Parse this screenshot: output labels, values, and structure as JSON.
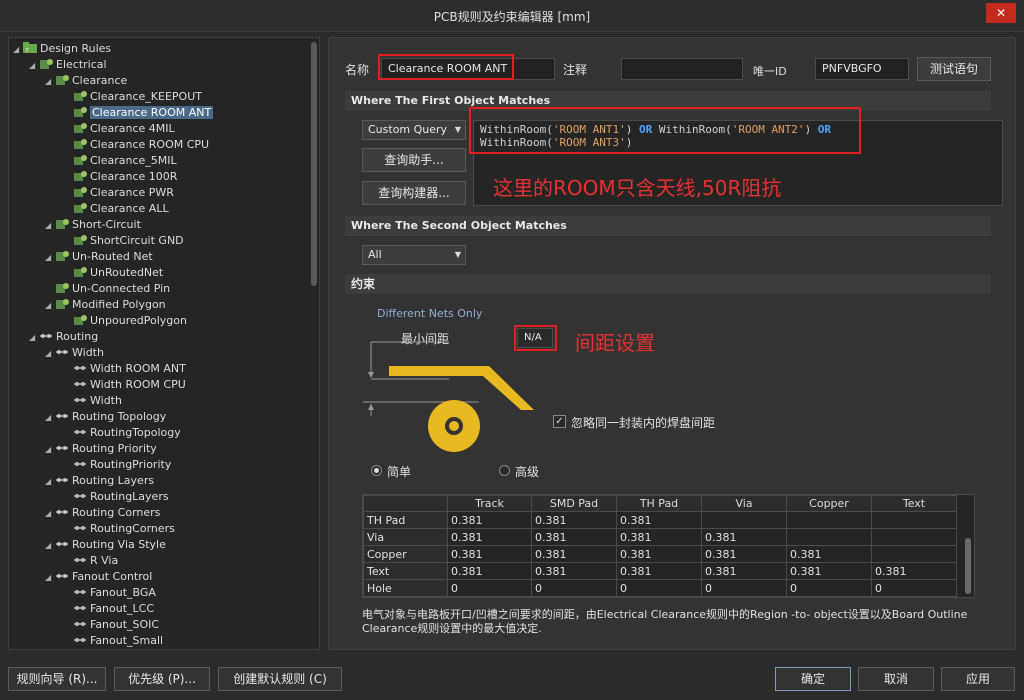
{
  "window": {
    "title": "PCB规则及约束编辑器 [mm]",
    "close_glyph": "✕"
  },
  "tree": {
    "items": [
      {
        "label": "Design Rules",
        "level": 0,
        "arrow": "◢",
        "icon": "folder-rules-icon"
      },
      {
        "label": "Electrical",
        "level": 1,
        "arrow": "◢",
        "icon": "category-icon"
      },
      {
        "label": "Clearance",
        "level": 2,
        "arrow": "◢",
        "icon": "category-icon"
      },
      {
        "label": "Clearance_KEEPOUT",
        "level": 3,
        "arrow": "",
        "icon": "rule-icon"
      },
      {
        "label": "Clearance ROOM ANT",
        "level": 3,
        "arrow": "",
        "icon": "rule-icon",
        "selected": true
      },
      {
        "label": "Clearance 4MIL",
        "level": 3,
        "arrow": "",
        "icon": "rule-icon"
      },
      {
        "label": "Clearance ROOM CPU",
        "level": 3,
        "arrow": "",
        "icon": "rule-icon"
      },
      {
        "label": "Clearance_5MIL",
        "level": 3,
        "arrow": "",
        "icon": "rule-icon"
      },
      {
        "label": "Clearance 100R",
        "level": 3,
        "arrow": "",
        "icon": "rule-icon"
      },
      {
        "label": "Clearance PWR",
        "level": 3,
        "arrow": "",
        "icon": "rule-icon"
      },
      {
        "label": "Clearance ALL",
        "level": 3,
        "arrow": "",
        "icon": "rule-icon"
      },
      {
        "label": "Short-Circuit",
        "level": 2,
        "arrow": "◢",
        "icon": "category-icon"
      },
      {
        "label": "ShortCircuit GND",
        "level": 3,
        "arrow": "",
        "icon": "rule-icon"
      },
      {
        "label": "Un-Routed Net",
        "level": 2,
        "arrow": "◢",
        "icon": "category-icon"
      },
      {
        "label": "UnRoutedNet",
        "level": 3,
        "arrow": "",
        "icon": "rule-icon"
      },
      {
        "label": "Un-Connected Pin",
        "level": 2,
        "arrow": "",
        "icon": "category-icon"
      },
      {
        "label": "Modified Polygon",
        "level": 2,
        "arrow": "◢",
        "icon": "category-icon"
      },
      {
        "label": "UnpouredPolygon",
        "level": 3,
        "arrow": "",
        "icon": "rule-icon"
      },
      {
        "label": "Routing",
        "level": 1,
        "arrow": "◢",
        "icon": "routing-icon"
      },
      {
        "label": "Width",
        "level": 2,
        "arrow": "◢",
        "icon": "routing-icon"
      },
      {
        "label": "Width ROOM ANT",
        "level": 3,
        "arrow": "",
        "icon": "routing-icon"
      },
      {
        "label": "Width ROOM CPU",
        "level": 3,
        "arrow": "",
        "icon": "routing-icon"
      },
      {
        "label": "Width",
        "level": 3,
        "arrow": "",
        "icon": "routing-icon"
      },
      {
        "label": "Routing Topology",
        "level": 2,
        "arrow": "◢",
        "icon": "routing-icon"
      },
      {
        "label": "RoutingTopology",
        "level": 3,
        "arrow": "",
        "icon": "routing-icon"
      },
      {
        "label": "Routing Priority",
        "level": 2,
        "arrow": "◢",
        "icon": "routing-icon"
      },
      {
        "label": "RoutingPriority",
        "level": 3,
        "arrow": "",
        "icon": "routing-icon"
      },
      {
        "label": "Routing Layers",
        "level": 2,
        "arrow": "◢",
        "icon": "routing-icon"
      },
      {
        "label": "RoutingLayers",
        "level": 3,
        "arrow": "",
        "icon": "routing-icon"
      },
      {
        "label": "Routing Corners",
        "level": 2,
        "arrow": "◢",
        "icon": "routing-icon"
      },
      {
        "label": "RoutingCorners",
        "level": 3,
        "arrow": "",
        "icon": "routing-icon"
      },
      {
        "label": "Routing Via Style",
        "level": 2,
        "arrow": "◢",
        "icon": "routing-icon"
      },
      {
        "label": "R Via",
        "level": 3,
        "arrow": "",
        "icon": "routing-icon"
      },
      {
        "label": "Fanout Control",
        "level": 2,
        "arrow": "◢",
        "icon": "routing-icon"
      },
      {
        "label": "Fanout_BGA",
        "level": 3,
        "arrow": "",
        "icon": "routing-icon"
      },
      {
        "label": "Fanout_LCC",
        "level": 3,
        "arrow": "",
        "icon": "routing-icon"
      },
      {
        "label": "Fanout_SOIC",
        "level": 3,
        "arrow": "",
        "icon": "routing-icon"
      },
      {
        "label": "Fanout_Small",
        "level": 3,
        "arrow": "",
        "icon": "routing-icon"
      }
    ]
  },
  "rule": {
    "name_label": "名称",
    "name_value": "Clearance ROOM ANT",
    "comment_label": "注释",
    "comment_value": "",
    "uid_label": "唯一ID",
    "uid_value": "PNFVBGFO",
    "test_button": "测试语句"
  },
  "first_match": {
    "header": "Where The First Object Matches",
    "dropdown": "Custom Query",
    "query_helper_button": "查询助手...",
    "query_builder_button": "查询构建器...",
    "query_line1": [
      {
        "t": "WithinRoom(",
        "c": "fn"
      },
      {
        "t": "'ROOM ANT1'",
        "c": "str"
      },
      {
        "t": ") ",
        "c": "fn"
      },
      {
        "t": "OR",
        "c": "kw"
      },
      {
        "t": " WithinRoom(",
        "c": "fn"
      },
      {
        "t": "'ROOM ANT2'",
        "c": "str"
      },
      {
        "t": ") ",
        "c": "fn"
      },
      {
        "t": "OR",
        "c": "kw"
      }
    ],
    "query_line2": [
      {
        "t": "WithinRoom(",
        "c": "fn"
      },
      {
        "t": "'ROOM ANT3'",
        "c": "str"
      },
      {
        "t": ")",
        "c": "fn"
      }
    ],
    "annotation": "这里的ROOM只含天线,50R阻抗"
  },
  "second_match": {
    "header": "Where The Second Object Matches",
    "dropdown": "All"
  },
  "constraints": {
    "header": "约束",
    "net_scope": "Different Nets Only",
    "min_clearance_label": "最小间距",
    "min_clearance_value": "N/A",
    "annotation": "间距设置",
    "ignore_pad_label": "忽略同一封装内的焊盘间距",
    "ignore_pad_checked": true,
    "radio_simple": "简单",
    "radio_advanced": "高级",
    "selected_mode": "simple"
  },
  "matrix": {
    "columns": [
      "",
      "Track",
      "SMD Pad",
      "TH Pad",
      "Via",
      "Copper",
      "Text"
    ],
    "rows": [
      [
        "TH Pad",
        "0.381",
        "0.381",
        "0.381",
        "",
        "",
        ""
      ],
      [
        "Via",
        "0.381",
        "0.381",
        "0.381",
        "0.381",
        "",
        ""
      ],
      [
        "Copper",
        "0.381",
        "0.381",
        "0.381",
        "0.381",
        "0.381",
        ""
      ],
      [
        "Text",
        "0.381",
        "0.381",
        "0.381",
        "0.381",
        "0.381",
        "0.381"
      ],
      [
        "Hole",
        "0",
        "0",
        "0",
        "0",
        "0",
        "0"
      ]
    ]
  },
  "note": "电气对象与电路板开口/凹槽之间要求的间距，由Electrical Clearance规则中的Region -to- object设置以及Board Outline Clearance规则设置中的最大值决定.",
  "footer": {
    "rule_wizard": "规则向导 (R)...",
    "priority": "优先级 (P)...",
    "create_default": "创建默认规则 (C)",
    "ok": "确定",
    "cancel": "取消",
    "apply": "应用"
  },
  "colors": {
    "annotation_red": "#e02020",
    "copper_gold": "#e8b820",
    "query_keyword": "#4fa3ff",
    "query_string": "#e0a060",
    "selection": "#4a6a8a"
  }
}
